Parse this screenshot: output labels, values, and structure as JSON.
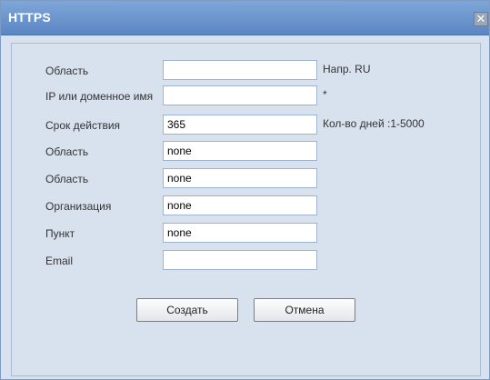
{
  "dialog": {
    "title": "HTTPS",
    "close_symbol": "✕"
  },
  "form": {
    "rows": [
      {
        "label": "Область",
        "value": "",
        "hint": "Напр. RU"
      },
      {
        "label": "IP или доменное имя",
        "value": "",
        "hint": "*"
      },
      {
        "label": "Срок действия",
        "value": "365",
        "hint": "Кол-во дней :1-5000"
      },
      {
        "label": "Область",
        "value": "none",
        "hint": ""
      },
      {
        "label": "Область",
        "value": "none",
        "hint": ""
      },
      {
        "label": "Организация",
        "value": "none",
        "hint": ""
      },
      {
        "label": "Пункт",
        "value": "none",
        "hint": ""
      },
      {
        "label": "Email",
        "value": "",
        "hint": ""
      }
    ]
  },
  "buttons": {
    "create_label": "Создать",
    "cancel_label": "Отмена"
  }
}
